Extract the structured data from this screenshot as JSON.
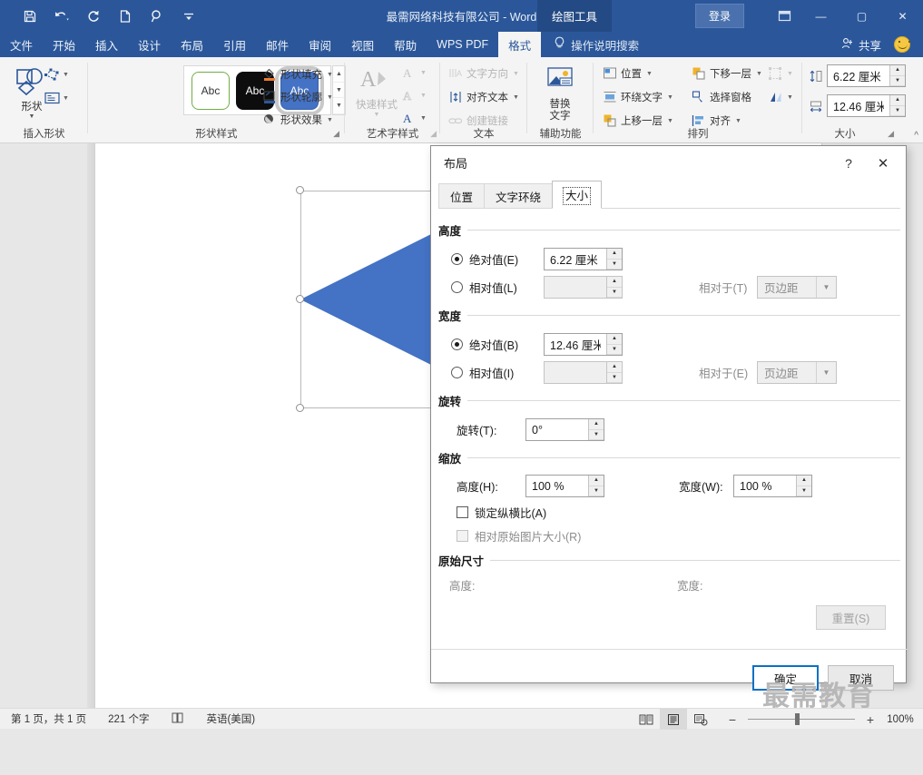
{
  "titlebar": {
    "document_title": "最需网络科技有限公司  -  Word",
    "context_tab": "绘图工具",
    "signin": "登录",
    "quick_access": [
      {
        "name": "save-icon",
        "label": "保存"
      },
      {
        "name": "undo-icon",
        "label": "撤消"
      },
      {
        "name": "redo-icon",
        "label": "恢复"
      },
      {
        "name": "new-doc-icon",
        "label": "新建"
      },
      {
        "name": "find-icon",
        "label": "查找"
      },
      {
        "name": "customize-qat-icon",
        "label": "自定义快速访问工具栏"
      }
    ],
    "window_buttons": {
      "ribbon_options": "功能区显示选项",
      "minimize": "—",
      "maximize": "▢",
      "close": "✕"
    }
  },
  "tabs": [
    {
      "label": "文件",
      "active": false
    },
    {
      "label": "开始",
      "active": false
    },
    {
      "label": "插入",
      "active": false
    },
    {
      "label": "设计",
      "active": false
    },
    {
      "label": "布局",
      "active": false
    },
    {
      "label": "引用",
      "active": false
    },
    {
      "label": "邮件",
      "active": false
    },
    {
      "label": "审阅",
      "active": false
    },
    {
      "label": "视图",
      "active": false
    },
    {
      "label": "帮助",
      "active": false
    },
    {
      "label": "WPS PDF",
      "active": false
    },
    {
      "label": "格式",
      "active": true
    }
  ],
  "tellme": "操作说明搜索",
  "share": "共享",
  "ribbon": {
    "groups": [
      {
        "name": "insert-shapes",
        "label": "插入形状"
      },
      {
        "name": "shape-styles",
        "label": "形状样式"
      },
      {
        "name": "wordart-styles",
        "label": "艺术字样式"
      },
      {
        "name": "text",
        "label": "文本"
      },
      {
        "name": "accessibility",
        "label": "辅助功能"
      },
      {
        "name": "arrange",
        "label": "排列"
      },
      {
        "name": "size",
        "label": "大小"
      }
    ],
    "insert_shapes": {
      "shapes_button": "形状",
      "edit_shape": "编辑形状",
      "text_box": "绘制文本框"
    },
    "shape_styles": {
      "gallery_items": [
        "Abc",
        "Abc",
        "Abc"
      ],
      "selected_index": 2,
      "shape_fill": "形状填充",
      "shape_outline": "形状轮廓",
      "shape_effects": "形状效果"
    },
    "wordart_styles": {
      "quick_styles": "快速样式",
      "text_fill": "文本填充",
      "text_outline": "文本轮廓",
      "text_effects": "文本效果"
    },
    "text_group": {
      "text_direction": "文字方向",
      "align_text": "对齐文本",
      "create_link": "创建链接"
    },
    "accessibility": {
      "alt_text_line1": "替换",
      "alt_text_line2": "文字"
    },
    "arrange": {
      "position": "位置",
      "wrap_text": "环绕文字",
      "bring_forward": "上移一层",
      "send_backward": "下移一层",
      "selection_pane": "选择窗格",
      "align": "对齐",
      "group": "组合",
      "rotate": "旋转"
    },
    "size": {
      "height_value": "6.22 厘米",
      "width_value": "12.46 厘米"
    }
  },
  "dialog": {
    "title": "布局",
    "help_glyph": "?",
    "close_glyph": "✕",
    "tabs": [
      {
        "label": "位置",
        "active": false
      },
      {
        "label": "文字环绕",
        "active": false
      },
      {
        "label": "大小",
        "active": true
      }
    ],
    "height_section": {
      "legend": "高度",
      "absolute_label": "绝对值(E)",
      "absolute_selected": true,
      "absolute_value": "6.22 厘米",
      "relative_label": "相对值(L)",
      "relative_selected": false,
      "relative_value": "",
      "relative_to_label": "相对于(T)",
      "relative_to_value": "页边距"
    },
    "width_section": {
      "legend": "宽度",
      "absolute_label": "绝对值(B)",
      "absolute_selected": true,
      "absolute_value": "12.46 厘米",
      "relative_label": "相对值(I)",
      "relative_selected": false,
      "relative_value": "",
      "relative_to_label": "相对于(E)",
      "relative_to_value": "页边距"
    },
    "rotate_section": {
      "legend": "旋转",
      "label": "旋转(T):",
      "value": "0°"
    },
    "scale_section": {
      "legend": "缩放",
      "height_label": "高度(H):",
      "height_value": "100 %",
      "width_label": "宽度(W):",
      "width_value": "100 %",
      "lock_aspect_label": "锁定纵横比(A)",
      "lock_aspect_checked": false,
      "relative_original_label": "相对原始图片大小(R)",
      "relative_original_checked": false,
      "relative_original_disabled": true
    },
    "original_size_section": {
      "legend": "原始尺寸",
      "height_label": "高度:",
      "height_value": "",
      "width_label": "宽度:",
      "width_value": "",
      "reset_button": "重置(S)"
    },
    "ok_button": "确定",
    "cancel_button": "取消"
  },
  "document": {
    "shape": {
      "name": "triangle-shape",
      "fill_color": "#4472c4",
      "direction": "left-pointing"
    }
  },
  "statusbar": {
    "page_info": "第 1 页，共 1 页",
    "word_count": "221 个字",
    "proofing": "校对",
    "language": "英语(美国)",
    "views": [
      {
        "name": "read-mode",
        "active": false
      },
      {
        "name": "print-layout",
        "active": true
      },
      {
        "name": "web-layout",
        "active": false
      }
    ],
    "zoom_out": "−",
    "zoom_in": "+",
    "zoom_level": "100%"
  },
  "watermark": "最需教育",
  "colors": {
    "title_bar": "#2b579a",
    "context_tab": "#234a84",
    "ribbon_bg": "#f4f4f4",
    "accent_blue": "#4472c4",
    "ok_focus": "#0b70c5"
  }
}
